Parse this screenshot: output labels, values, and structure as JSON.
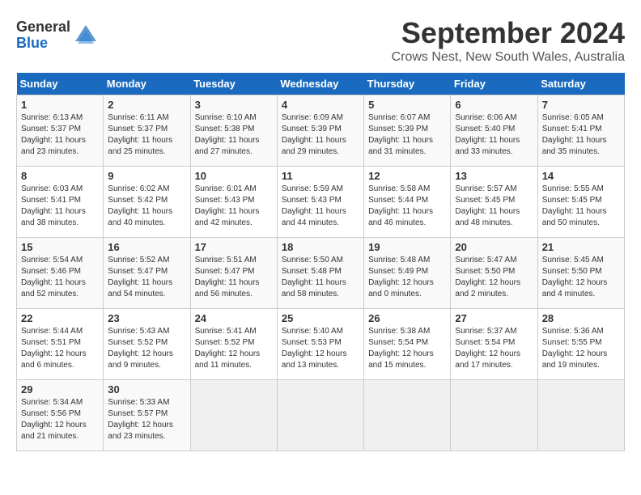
{
  "header": {
    "logo_general": "General",
    "logo_blue": "Blue",
    "title": "September 2024",
    "location": "Crows Nest, New South Wales, Australia"
  },
  "calendar": {
    "days_of_week": [
      "Sunday",
      "Monday",
      "Tuesday",
      "Wednesday",
      "Thursday",
      "Friday",
      "Saturday"
    ],
    "weeks": [
      [
        {
          "day": "",
          "info": ""
        },
        {
          "day": "2",
          "info": "Sunrise: 6:11 AM\nSunset: 5:37 PM\nDaylight: 11 hours\nand 25 minutes."
        },
        {
          "day": "3",
          "info": "Sunrise: 6:10 AM\nSunset: 5:38 PM\nDaylight: 11 hours\nand 27 minutes."
        },
        {
          "day": "4",
          "info": "Sunrise: 6:09 AM\nSunset: 5:39 PM\nDaylight: 11 hours\nand 29 minutes."
        },
        {
          "day": "5",
          "info": "Sunrise: 6:07 AM\nSunset: 5:39 PM\nDaylight: 11 hours\nand 31 minutes."
        },
        {
          "day": "6",
          "info": "Sunrise: 6:06 AM\nSunset: 5:40 PM\nDaylight: 11 hours\nand 33 minutes."
        },
        {
          "day": "7",
          "info": "Sunrise: 6:05 AM\nSunset: 5:41 PM\nDaylight: 11 hours\nand 35 minutes."
        }
      ],
      [
        {
          "day": "8",
          "info": "Sunrise: 6:03 AM\nSunset: 5:41 PM\nDaylight: 11 hours\nand 38 minutes."
        },
        {
          "day": "9",
          "info": "Sunrise: 6:02 AM\nSunset: 5:42 PM\nDaylight: 11 hours\nand 40 minutes."
        },
        {
          "day": "10",
          "info": "Sunrise: 6:01 AM\nSunset: 5:43 PM\nDaylight: 11 hours\nand 42 minutes."
        },
        {
          "day": "11",
          "info": "Sunrise: 5:59 AM\nSunset: 5:43 PM\nDaylight: 11 hours\nand 44 minutes."
        },
        {
          "day": "12",
          "info": "Sunrise: 5:58 AM\nSunset: 5:44 PM\nDaylight: 11 hours\nand 46 minutes."
        },
        {
          "day": "13",
          "info": "Sunrise: 5:57 AM\nSunset: 5:45 PM\nDaylight: 11 hours\nand 48 minutes."
        },
        {
          "day": "14",
          "info": "Sunrise: 5:55 AM\nSunset: 5:45 PM\nDaylight: 11 hours\nand 50 minutes."
        }
      ],
      [
        {
          "day": "15",
          "info": "Sunrise: 5:54 AM\nSunset: 5:46 PM\nDaylight: 11 hours\nand 52 minutes."
        },
        {
          "day": "16",
          "info": "Sunrise: 5:52 AM\nSunset: 5:47 PM\nDaylight: 11 hours\nand 54 minutes."
        },
        {
          "day": "17",
          "info": "Sunrise: 5:51 AM\nSunset: 5:47 PM\nDaylight: 11 hours\nand 56 minutes."
        },
        {
          "day": "18",
          "info": "Sunrise: 5:50 AM\nSunset: 5:48 PM\nDaylight: 11 hours\nand 58 minutes."
        },
        {
          "day": "19",
          "info": "Sunrise: 5:48 AM\nSunset: 5:49 PM\nDaylight: 12 hours\nand 0 minutes."
        },
        {
          "day": "20",
          "info": "Sunrise: 5:47 AM\nSunset: 5:50 PM\nDaylight: 12 hours\nand 2 minutes."
        },
        {
          "day": "21",
          "info": "Sunrise: 5:45 AM\nSunset: 5:50 PM\nDaylight: 12 hours\nand 4 minutes."
        }
      ],
      [
        {
          "day": "22",
          "info": "Sunrise: 5:44 AM\nSunset: 5:51 PM\nDaylight: 12 hours\nand 6 minutes."
        },
        {
          "day": "23",
          "info": "Sunrise: 5:43 AM\nSunset: 5:52 PM\nDaylight: 12 hours\nand 9 minutes."
        },
        {
          "day": "24",
          "info": "Sunrise: 5:41 AM\nSunset: 5:52 PM\nDaylight: 12 hours\nand 11 minutes."
        },
        {
          "day": "25",
          "info": "Sunrise: 5:40 AM\nSunset: 5:53 PM\nDaylight: 12 hours\nand 13 minutes."
        },
        {
          "day": "26",
          "info": "Sunrise: 5:38 AM\nSunset: 5:54 PM\nDaylight: 12 hours\nand 15 minutes."
        },
        {
          "day": "27",
          "info": "Sunrise: 5:37 AM\nSunset: 5:54 PM\nDaylight: 12 hours\nand 17 minutes."
        },
        {
          "day": "28",
          "info": "Sunrise: 5:36 AM\nSunset: 5:55 PM\nDaylight: 12 hours\nand 19 minutes."
        }
      ],
      [
        {
          "day": "29",
          "info": "Sunrise: 5:34 AM\nSunset: 5:56 PM\nDaylight: 12 hours\nand 21 minutes."
        },
        {
          "day": "30",
          "info": "Sunrise: 5:33 AM\nSunset: 5:57 PM\nDaylight: 12 hours\nand 23 minutes."
        },
        {
          "day": "",
          "info": ""
        },
        {
          "day": "",
          "info": ""
        },
        {
          "day": "",
          "info": ""
        },
        {
          "day": "",
          "info": ""
        },
        {
          "day": "",
          "info": ""
        }
      ]
    ],
    "week0_sun": {
      "day": "1",
      "info": "Sunrise: 6:13 AM\nSunset: 5:37 PM\nDaylight: 11 hours\nand 23 minutes."
    }
  }
}
